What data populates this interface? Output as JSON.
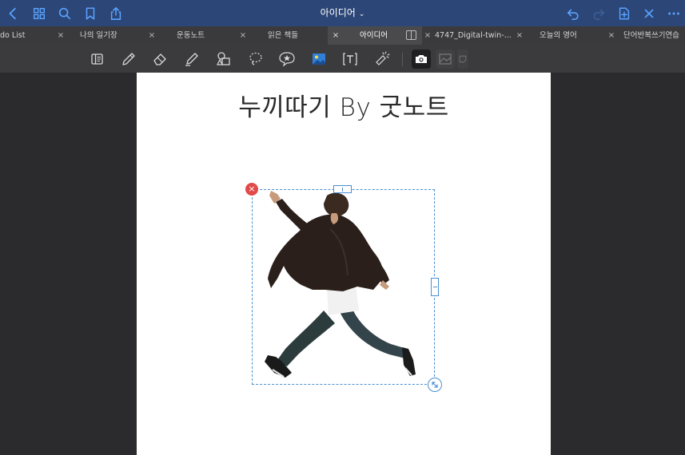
{
  "topbar": {
    "title": "아이디어",
    "title_chevron": "⌄",
    "left_icons": [
      "back-icon",
      "grid-icon",
      "search-icon",
      "bookmark-icon",
      "share-icon"
    ],
    "right_icons": [
      "undo-icon",
      "redo-icon",
      "add-page-icon",
      "close-icon",
      "more-icon"
    ],
    "accent_color": "#2c4677",
    "icon_color": "#5aa3ff"
  },
  "tabs": [
    {
      "label": "do List"
    },
    {
      "label": "나의 일기장"
    },
    {
      "label": "운동노트"
    },
    {
      "label": "읽은 책들"
    },
    {
      "label": "아이디어",
      "active": true
    },
    {
      "label": "4747_Digital-twin-..."
    },
    {
      "label": "오늘의 영어"
    },
    {
      "label": "단어반복쓰기연습"
    }
  ],
  "tab_close_glyph": "×",
  "toolbar": {
    "tools": [
      "reader-mode-icon",
      "pen-icon",
      "eraser-icon",
      "highlighter-icon",
      "shapes-icon",
      "lasso-icon",
      "elements-icon",
      "image-icon",
      "text-box-icon",
      "laser-pointer-icon",
      "camera-icon",
      "photo-picker-icon",
      "sticker-icon"
    ],
    "selected": "camera-icon"
  },
  "page": {
    "heading": "누끼따기 By 굿노트"
  },
  "selection": {
    "delete_glyph": "×"
  }
}
